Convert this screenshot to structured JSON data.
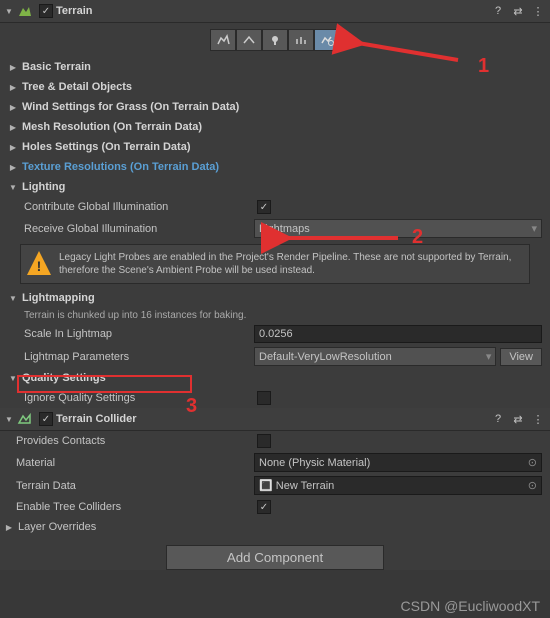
{
  "terrain": {
    "title": "Terrain",
    "sections": {
      "basic": "Basic Terrain",
      "tree": "Tree & Detail Objects",
      "wind": "Wind Settings for Grass (On Terrain Data)",
      "mesh": "Mesh Resolution (On Terrain Data)",
      "holes": "Holes Settings (On Terrain Data)",
      "texres": "Texture Resolutions (On Terrain Data)",
      "lighting": "Lighting",
      "lightmapping": "Lightmapping",
      "quality": "Quality Settings"
    },
    "lighting": {
      "contribute_gi": "Contribute Global Illumination",
      "receive_gi": "Receive Global Illumination",
      "receive_gi_value": "Lightmaps",
      "warning": "Legacy Light Probes are enabled in the Project's Render Pipeline. These are not supported by Terrain, therefore the Scene's Ambient Probe will be used instead."
    },
    "lightmapping": {
      "chunk_note": "Terrain is chunked up into 16 instances for baking.",
      "scale_label": "Scale In Lightmap",
      "scale_value": "0.0256",
      "params_label": "Lightmap Parameters",
      "params_value": "Default-VeryLowResolution",
      "view_btn": "View"
    },
    "quality": {
      "ignore": "Ignore Quality Settings"
    }
  },
  "collider": {
    "title": "Terrain Collider",
    "provides_contacts": "Provides Contacts",
    "material_label": "Material",
    "material_value": "None (Physic Material)",
    "terrain_data_label": "Terrain Data",
    "terrain_data_value": "New Terrain",
    "enable_tree": "Enable Tree Colliders",
    "layer_overrides": "Layer Overrides"
  },
  "add_component": "Add Component",
  "annotations": {
    "n1": "1",
    "n2": "2",
    "n3": "3"
  },
  "watermark": "CSDN @EucliwoodXT"
}
